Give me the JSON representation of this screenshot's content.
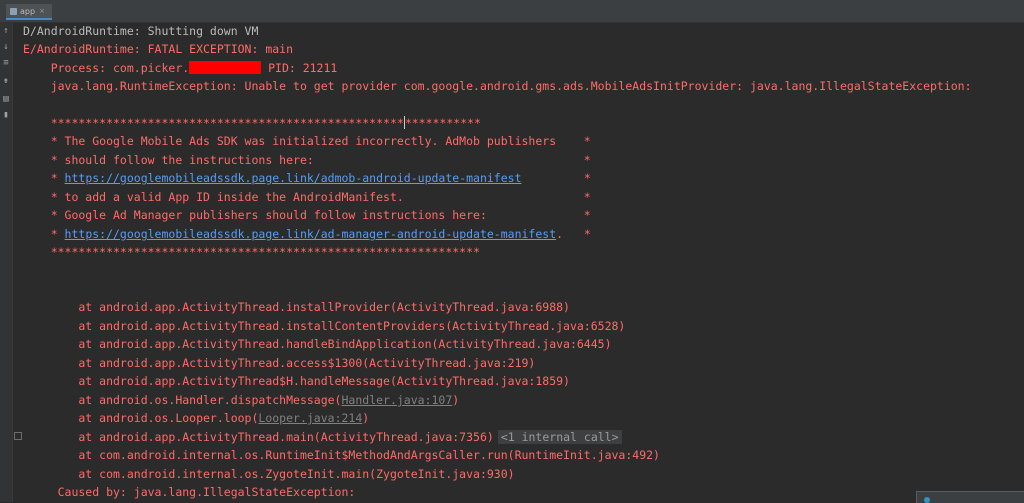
{
  "tab": {
    "label": "app"
  },
  "console": {
    "line1": "D/AndroidRuntime: Shutting down VM",
    "line2": "E/AndroidRuntime: FATAL EXCEPTION: main",
    "line3_prefix": "    Process: com.picker.",
    "line3_suffix": " PID: 21211",
    "line4": "    java.lang.RuntimeException: Unable to get provider com.google.android.gms.ads.MobileAdsInitProvider: java.lang.IllegalStateException:",
    "stars_a": "    ***************************************************",
    "stars_b": "***********",
    "msg1": "    * The Google Mobile Ads SDK was initialized incorrectly. AdMob publishers    *",
    "msg2": "    * should follow the instructions here:                                       *",
    "msg3_prefix": "    * ",
    "msg3_link": "https://googlemobileadssdk.page.link/admob-android-update-manifest",
    "msg3_suffix": "         *",
    "msg4": "    * to add a valid App ID inside the AndroidManifest.                          *",
    "msg5": "    * Google Ad Manager publishers should follow instructions here:              *",
    "msg6_prefix": "    * ",
    "msg6_link": "https://googlemobileadssdk.page.link/ad-manager-android-update-manifest",
    "msg6_suffix": ".   *",
    "stars_full": "    **************************************************************",
    "st1": "        at android.app.ActivityThread.installProvider(ActivityThread.java:6988)",
    "st2": "        at android.app.ActivityThread.installContentProviders(ActivityThread.java:6528)",
    "st3": "        at android.app.ActivityThread.handleBindApplication(ActivityThread.java:6445)",
    "st4": "        at android.app.ActivityThread.access$1300(ActivityThread.java:219)",
    "st5": "        at android.app.ActivityThread$H.handleMessage(ActivityThread.java:1859)",
    "st6_prefix": "        at android.os.Handler.dispatchMessage(",
    "st6_ref": "Handler.java:107",
    "st6_suffix": ")",
    "st7_prefix": "        at android.os.Looper.loop(",
    "st7_ref": "Looper.java:214",
    "st7_suffix": ")",
    "st8": "        at android.app.ActivityThread.main(ActivityThread.java:7356)",
    "st8_hint": "<1 internal call>",
    "st9": "        at com.android.internal.os.RuntimeInit$MethodAndArgsCaller.run(RuntimeInit.java:492)",
    "st10": "        at com.android.internal.os.ZygoteInit.main(ZygoteInit.java:930)",
    "caused": "     Caused by: java.lang.IllegalStateException:"
  }
}
